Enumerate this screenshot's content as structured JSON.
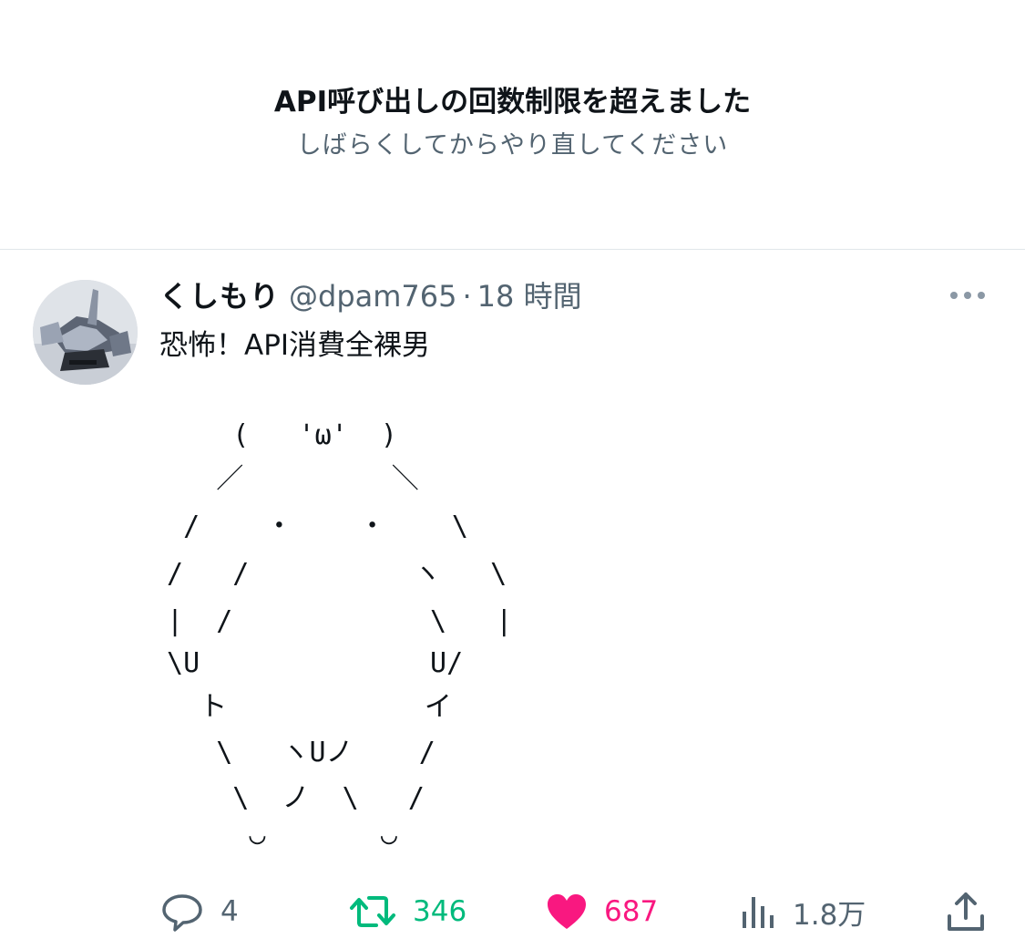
{
  "banner": {
    "title": "API呼び出しの回数制限を超えました",
    "subtitle": "しばらくしてからやり直してください"
  },
  "tweet": {
    "display_name": "くしもり",
    "handle": "@dpam765",
    "separator": "·",
    "time": "18 時間",
    "text": "恐怖！API消費全裸男",
    "ascii_art": [
      "     (   'ω'  )",
      "    ／         ＼",
      "  /    ・    ・    \\",
      " /   /          ヽ   \\",
      " |  /            \\   |",
      " \\U              U/",
      "   ト            イ",
      "    \\   ヽUノ    /",
      "     \\  ノ  \\   /",
      "      ◡       ◡"
    ]
  },
  "actions": {
    "reply_count": "4",
    "retweet_count": "346",
    "like_count": "687",
    "views_count": "1.8万"
  },
  "icons": {
    "reply": "reply-icon",
    "retweet": "retweet-icon",
    "like": "heart-icon",
    "views": "views-icon",
    "share": "share-icon",
    "more": "more-icon"
  },
  "colors": {
    "text": "#0f1419",
    "secondary": "#536471",
    "retweet": "#00ba7c",
    "like": "#f91880",
    "divider": "#e1e6ea"
  }
}
